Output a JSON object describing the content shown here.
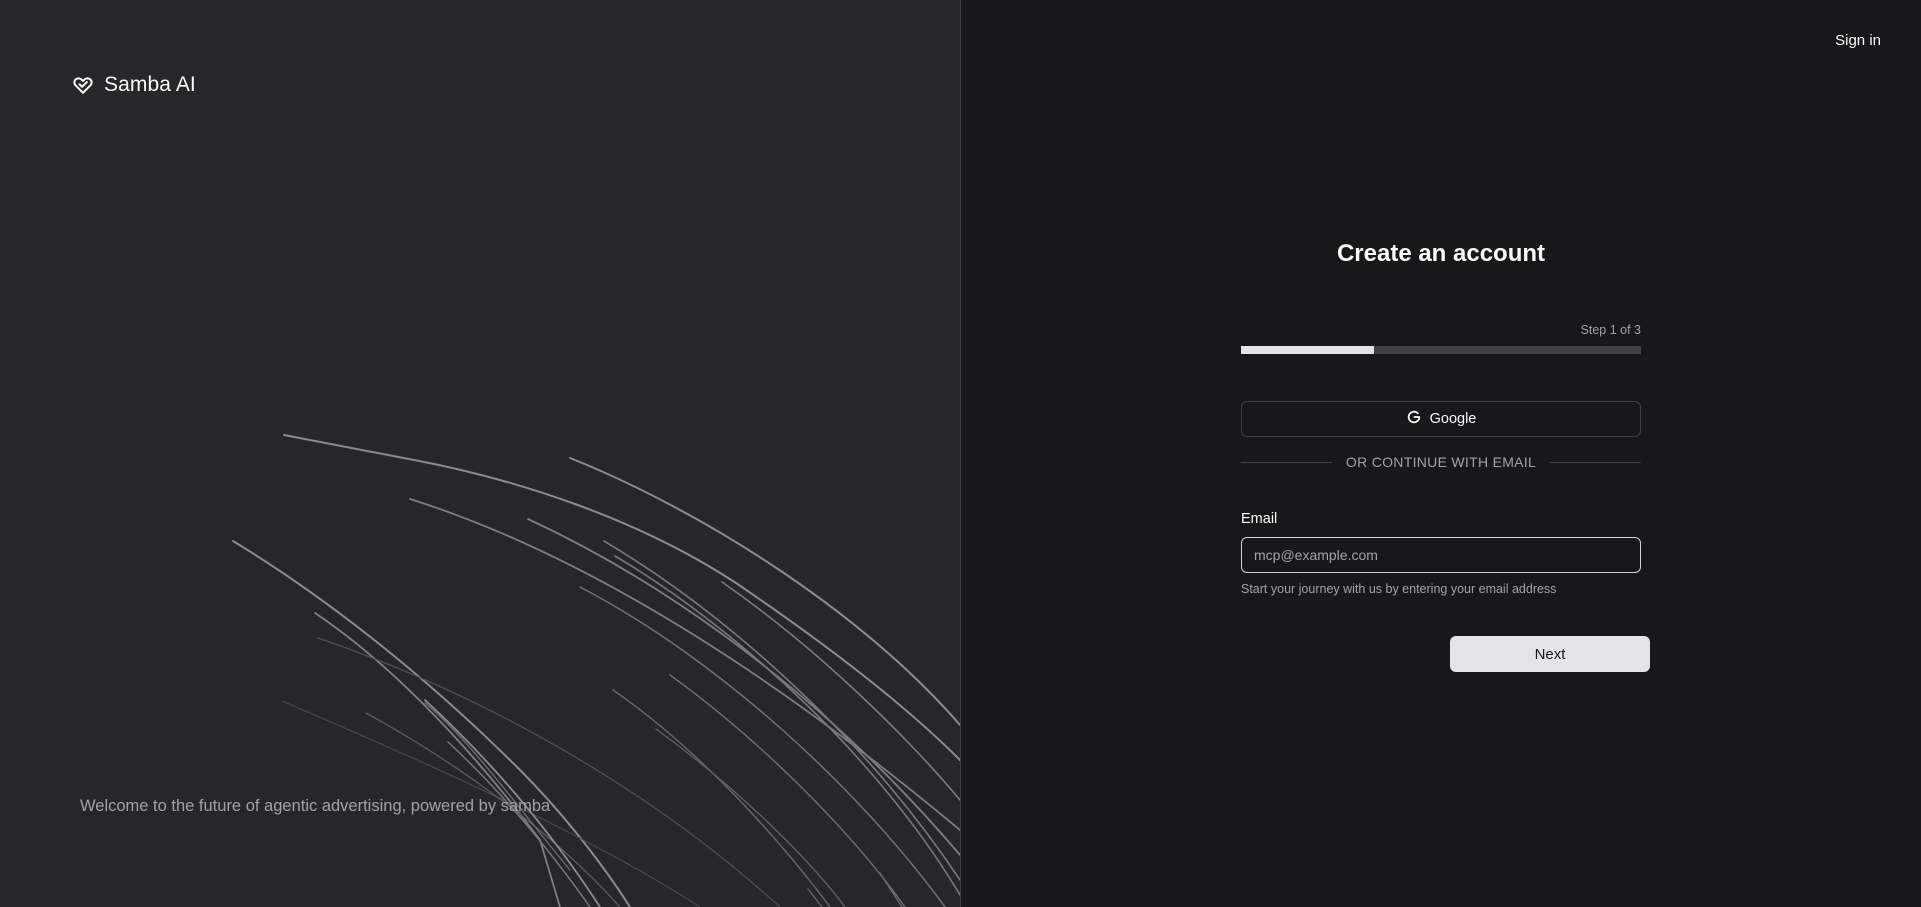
{
  "brand": {
    "name": "Samba AI",
    "icon": "heart-check-icon"
  },
  "left_panel": {
    "tagline": "Welcome to the future of agentic advertising, powered by samba"
  },
  "header": {
    "signin_label": "Sign in"
  },
  "signup": {
    "title": "Create an account",
    "step_text": "Step 1 of 3",
    "progress_fraction": 0.333,
    "google_label": "Google",
    "google_icon": "google-icon",
    "divider_text": "OR CONTINUE WITH EMAIL",
    "email_label": "Email",
    "email_placeholder": "mcp@example.com",
    "email_value": "",
    "email_hint": "Start your journey with us by entering your email address",
    "next_label": "Next"
  },
  "colors": {
    "left_bg": "#27272a",
    "right_bg": "#18181b",
    "progress_fill": "#e4e4e7",
    "progress_track": "#3f3f46",
    "next_bg": "#e4e4e7"
  }
}
